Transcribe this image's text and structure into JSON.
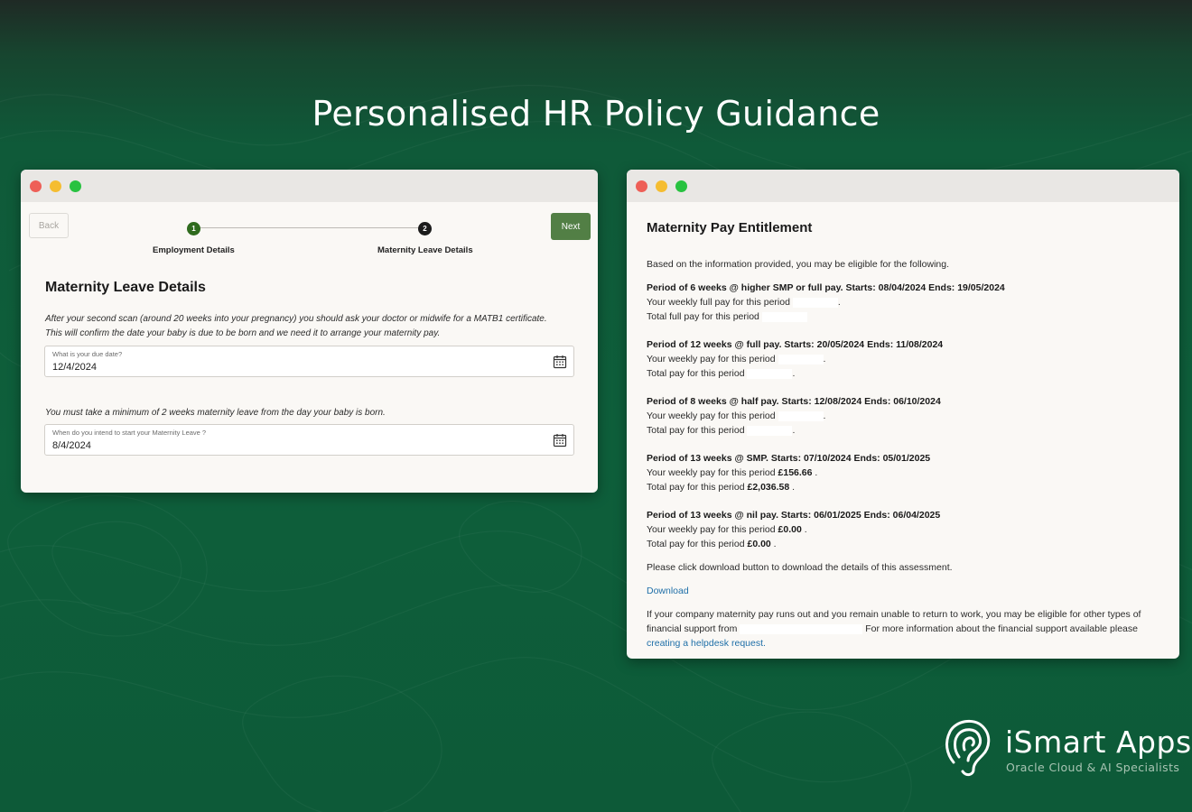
{
  "page": {
    "heading": "Personalised HR Policy Guidance"
  },
  "colors": {
    "background": "#0e5f3b",
    "accent_green": "#527f45",
    "link": "#1f6fa8"
  },
  "form_window": {
    "back_label": "Back",
    "next_label": "Next",
    "steps": [
      {
        "number": "1",
        "label": "Employment Details",
        "state": "completed"
      },
      {
        "number": "2",
        "label": "Maternity Leave Details",
        "state": "current"
      }
    ],
    "section_title": "Maternity Leave Details",
    "instruction_1": "After your second scan (around 20 weeks into your pregnancy) you should ask your doctor or midwife for a MATB1 certificate. This will confirm the date your baby is due to be born and we need it to arrange your maternity pay.",
    "due_date_label": "What is your due date?",
    "due_date_value": "12/4/2024",
    "instruction_2": "You must take a minimum of 2 weeks maternity leave from the day your baby is born.",
    "start_date_label": "When do you intend to start your Maternity Leave ?",
    "start_date_value": "8/4/2024",
    "calendar_icon": "calendar-icon"
  },
  "result_window": {
    "title": "Maternity Pay Entitlement",
    "intro": "Based on the information provided, you may be eligible for the following.",
    "periods": [
      {
        "heading": "Period of 6 weeks @ higher SMP or full pay. Starts: 08/04/2024 Ends: 19/05/2024",
        "weekly_label": "Your weekly full pay for this period",
        "weekly_value": "",
        "total_label": "Total full pay for this period",
        "total_value": ""
      },
      {
        "heading": "Period of 12 weeks @ full pay. Starts: 20/05/2024 Ends: 11/08/2024",
        "weekly_label": "Your weekly pay for this period",
        "weekly_value": "",
        "total_label": "Total pay for this period",
        "total_value": ""
      },
      {
        "heading": "Period of 8 weeks @ half pay. Starts: 12/08/2024 Ends: 06/10/2024",
        "weekly_label": "Your weekly pay for this period",
        "weekly_value": "",
        "total_label": "Total pay for this period",
        "total_value": ""
      },
      {
        "heading": "Period of 13 weeks @ SMP. Starts: 07/10/2024 Ends: 05/01/2025",
        "weekly_label": "Your weekly pay for this period",
        "weekly_value": "£156.66",
        "total_label": "Total pay for this period",
        "total_value": "£2,036.58"
      },
      {
        "heading": "Period of 13 weeks @ nil pay. Starts: 06/01/2025 Ends: 06/04/2025",
        "weekly_label": "Your weekly pay for this period",
        "weekly_value": "£0.00",
        "total_label": "Total pay for this period",
        "total_value": "£0.00"
      }
    ],
    "download_note": "Please click download button to download the details of this assessment.",
    "download_link": "Download",
    "footer_line_1": "If your company maternity pay runs out and you remain unable to return to work, you may be eligible for other types of",
    "footer_line_2_start": "financial support from",
    "footer_line_2_end": "For more information about the financial support available please",
    "footer_link": "creating a helpdesk request."
  },
  "brand": {
    "name": "iSmart Apps",
    "tagline": "Oracle Cloud & AI Specialists",
    "logo_icon": "ear-logo-icon"
  }
}
